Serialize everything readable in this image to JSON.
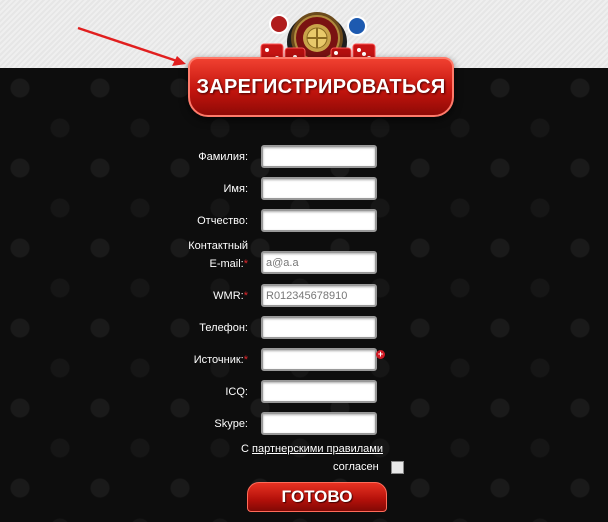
{
  "header": {
    "register_title": "ЗАРЕГИСТРИРОВАТЬСЯ"
  },
  "form": {
    "fields": [
      {
        "label": "Фамилия:",
        "value": "",
        "required": false
      },
      {
        "label": "Имя:",
        "value": "",
        "required": false
      },
      {
        "label": "Отчество:",
        "value": "",
        "required": false
      },
      {
        "label_line1": "Контактный",
        "label": "E-mail:",
        "value": "a@a.a",
        "required": true
      },
      {
        "label": "WMR:",
        "value": "R012345678910",
        "required": true
      },
      {
        "label": "Телефон:",
        "value": "",
        "required": false
      },
      {
        "label": "Источник:",
        "value": "",
        "required": true
      },
      {
        "label": "ICQ:",
        "value": "",
        "required": false
      },
      {
        "label": "Skype:",
        "value": "",
        "required": false
      }
    ],
    "required_mark": "*",
    "agree_prefix": "С",
    "agree_link": "партнерскими правилами",
    "agree_suffix": "согласен",
    "add_icon": "plus-icon",
    "submit_label": "ГОТОВО"
  },
  "colors": {
    "accent_red": "#c4150e",
    "required_red": "#e0262b",
    "background": "#0d0d0d"
  }
}
